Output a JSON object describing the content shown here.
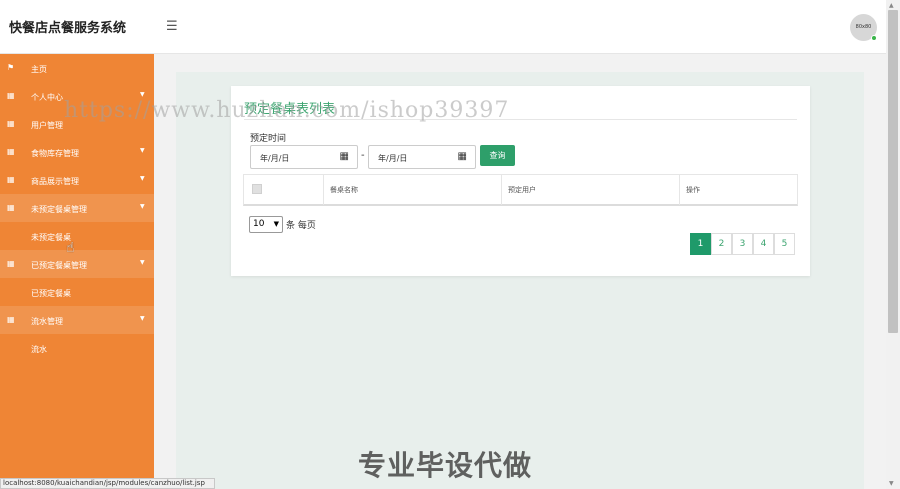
{
  "header": {
    "title": "快餐店点餐服务系统",
    "menu_icon": "hamburger-icon",
    "avatar_text": "80x80"
  },
  "sidebar": {
    "items": [
      {
        "label": "主页",
        "icon": "flag-icon"
      },
      {
        "label": "个人中心",
        "icon": "grid-icon"
      },
      {
        "label": "用户管理",
        "icon": "grid-icon"
      },
      {
        "label": "食物库存管理",
        "icon": "grid-icon"
      },
      {
        "label": "商品展示管理",
        "icon": "grid-icon"
      },
      {
        "label": "未预定餐桌管理",
        "icon": "grid-icon"
      },
      {
        "label": "未预定餐桌"
      },
      {
        "label": "已预定餐桌管理",
        "icon": "grid-icon"
      },
      {
        "label": "已预定餐桌"
      },
      {
        "label": "流水管理",
        "icon": "grid-icon"
      },
      {
        "label": "流水"
      }
    ],
    "color": "#ef8535"
  },
  "main": {
    "card_title": "预定餐桌表列表",
    "filter_label": "预定时间",
    "date_from_placeholder": "年/月/日",
    "date_to_placeholder": "年/月/日",
    "range_separator": "-",
    "search_button": "查询",
    "table_headers": [
      "餐桌名称",
      "预定用户",
      "操作"
    ],
    "page_size_value": "10",
    "page_size_suffix": "条 每页",
    "pages": [
      "1",
      "2",
      "3",
      "4",
      "5"
    ],
    "current_page": "1",
    "accent": "#3ea571"
  },
  "overlay": {
    "watermark": "https://www.huzhan.com/ishop39397",
    "bottom_text": "专业毕设代做"
  },
  "statusbar": {
    "url": "localhost:8080/kuaichandian/jsp/modules/canzhuo/list.jsp"
  }
}
